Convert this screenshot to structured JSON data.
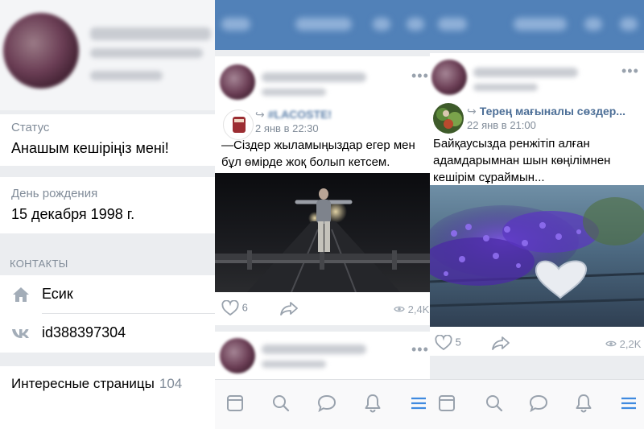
{
  "profile": {
    "status_label": "Статус",
    "status_value": "Анашым кешіріңіз мені!",
    "birthday_label": "День рождения",
    "birthday_value": "15 декабря 1998 г.",
    "contacts_header": "КОНТАКТЫ",
    "city": "Есик",
    "vk_id": "id388397304",
    "interesting_label": "Интересные страницы",
    "interesting_count": "104"
  },
  "feed_left": {
    "repost": {
      "source_name": "#LACOSTE!",
      "date": "2 янв в 22:30",
      "text": "—Сіздер жыламыңыздар егер мен бұл өмірде жоқ болып кетсем."
    },
    "likes": "6",
    "views": "2,4K"
  },
  "feed_right": {
    "repost": {
      "source_name": "Терең мағыналы сөздер...",
      "date": "22 янв в 21:00",
      "text": "Байқаусызда ренжітіп алған адамдарымнан шын көңілімнен кешірім сұраймын..."
    },
    "likes": "5",
    "views": "2,2K"
  },
  "colors": {
    "header_blue": "#5181b8",
    "link_blue": "#2a5885",
    "muted": "#818c99",
    "tab_active": "#3f8ae0"
  },
  "icons": {
    "city": "home-icon",
    "vk": "vk-logo-icon",
    "like": "heart-icon",
    "share": "share-arrow-icon",
    "views": "eye-icon",
    "tabs": [
      "news-icon",
      "search-icon",
      "messages-icon",
      "notifications-icon",
      "menu-icon"
    ]
  }
}
